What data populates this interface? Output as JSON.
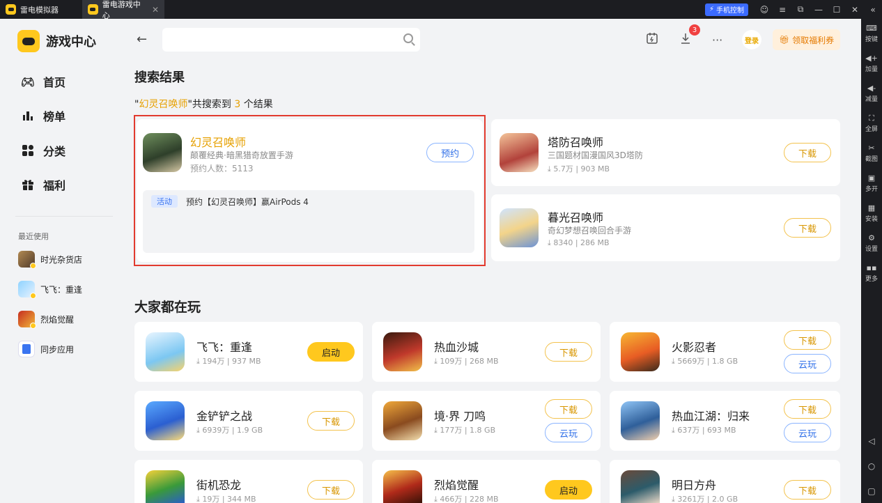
{
  "titlebar": {
    "tabs": [
      {
        "label": "雷电模拟器"
      },
      {
        "label": "雷电游戏中心"
      }
    ],
    "phone_control": "手机控制"
  },
  "toolbar": {
    "items": [
      {
        "label": "按键",
        "icon": "keyboard-icon"
      },
      {
        "label": "加量",
        "icon": "volume-up-icon"
      },
      {
        "label": "减量",
        "icon": "volume-down-icon"
      },
      {
        "label": "全屏",
        "icon": "fullscreen-icon"
      },
      {
        "label": "截图",
        "icon": "scissors-icon"
      },
      {
        "label": "多开",
        "icon": "multi-instance-icon"
      },
      {
        "label": "安装",
        "icon": "install-icon"
      },
      {
        "label": "设置",
        "icon": "settings-icon"
      },
      {
        "label": "更多",
        "icon": "more-icon"
      }
    ]
  },
  "sidebar": {
    "title": "游戏中心",
    "nav": [
      {
        "label": "首页",
        "icon": "gamepad-icon"
      },
      {
        "label": "榜单",
        "icon": "ranking-icon"
      },
      {
        "label": "分类",
        "icon": "category-icon"
      },
      {
        "label": "福利",
        "icon": "gift-icon"
      }
    ],
    "recent_title": "最近使用",
    "recent": [
      {
        "label": "时光杂货店"
      },
      {
        "label": "飞飞：重逢"
      },
      {
        "label": "烈焰觉醒"
      },
      {
        "label": "同步应用"
      }
    ]
  },
  "header": {
    "search_value": "",
    "download_count": "3",
    "login": "登录",
    "coupon": "领取福利券"
  },
  "search": {
    "title": "搜索结果",
    "quote_open": "\"",
    "keyword": "幻灵召唤师",
    "mid": "\"共搜索到 ",
    "count": "3",
    "suffix": " 个结果",
    "featured": {
      "name": "幻灵召唤师",
      "desc": "颠覆经典·暗黑猎奇放置手游",
      "meta": "预约人数：5113",
      "button": "预约",
      "activity_tag": "活动",
      "activity_text": "预约【幻灵召唤师】赢AirPods 4"
    },
    "others": [
      {
        "name": "塔防召唤师",
        "desc": "三国题材国漫国风3D塔防",
        "meta": "⤓ 5.7万 | 903 MB",
        "button": "下载"
      },
      {
        "name": "暮光召唤师",
        "desc": "奇幻梦想召唤回合手游",
        "meta": "⤓ 8340 | 286 MB",
        "button": "下载"
      }
    ]
  },
  "popular": {
    "title": "大家都在玩",
    "games": [
      {
        "name": "飞飞：重逢",
        "meta": "⤓ 194万 | 937 MB",
        "button": "启动"
      },
      {
        "name": "热血沙城",
        "meta": "⤓ 109万 | 268 MB",
        "button": "下载"
      },
      {
        "name": "火影忍者",
        "meta": "⤓ 5669万 | 1.8 GB",
        "button": "下载",
        "button2": "云玩"
      },
      {
        "name": "金铲铲之战",
        "meta": "⤓ 6939万 | 1.9 GB",
        "button": "下载"
      },
      {
        "name": "境·界 刀鸣",
        "meta": "⤓ 177万 | 1.8 GB",
        "button": "下载",
        "button2": "云玩"
      },
      {
        "name": "热血江湖：归来",
        "meta": "⤓ 637万 | 693 MB",
        "button": "下载",
        "button2": "云玩"
      },
      {
        "name": "街机恐龙",
        "meta": "⤓ 19万 | 344 MB",
        "button": "下载"
      },
      {
        "name": "烈焰觉醒",
        "meta": "⤓ 466万 | 228 MB",
        "button": "启动"
      },
      {
        "name": "明日方舟",
        "meta": "⤓ 3261万 | 2.0 GB",
        "button": "下载"
      }
    ]
  }
}
